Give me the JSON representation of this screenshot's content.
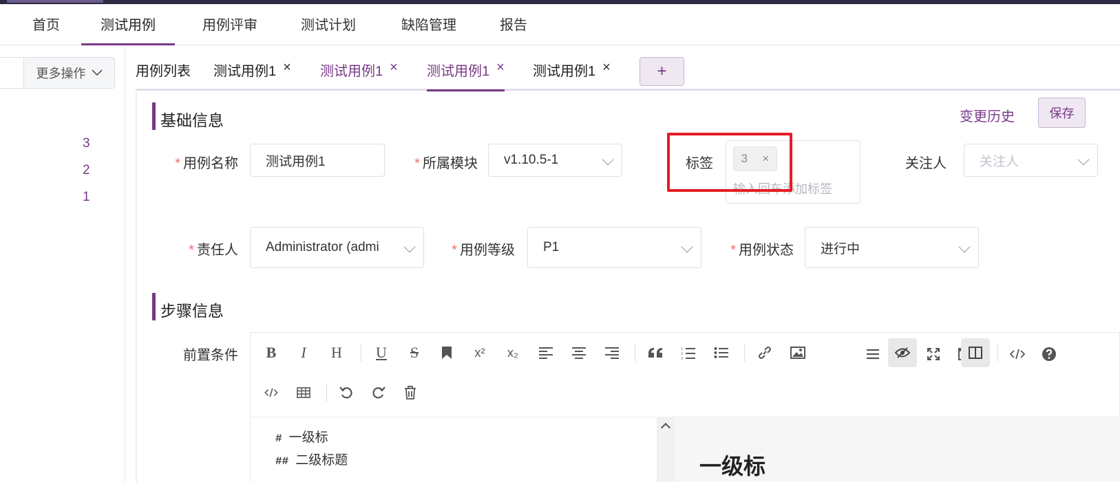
{
  "nav": {
    "items": [
      {
        "label": "首页"
      },
      {
        "label": "测试用例"
      },
      {
        "label": "用例评审"
      },
      {
        "label": "测试计划"
      },
      {
        "label": "缺陷管理"
      },
      {
        "label": "报告"
      }
    ],
    "active": "测试用例"
  },
  "left": {
    "more_label": "更多操作",
    "counts": [
      "3",
      "2",
      "1"
    ]
  },
  "tabs": {
    "items": [
      {
        "label": "用例列表"
      },
      {
        "label": "测试用例1"
      },
      {
        "label": "测试用例1"
      },
      {
        "label": "测试用例1"
      },
      {
        "label": "测试用例1"
      }
    ],
    "close_glyph": "×",
    "add_glyph": "+"
  },
  "basic": {
    "title": "基础信息",
    "history_label": "变更历史",
    "save_label": "保存",
    "name_label": "用例名称",
    "name_value": "测试用例1",
    "module_label": "所属模块",
    "module_value": "v1.10.5-1",
    "tag_label": "标签",
    "tag_chip": "3",
    "tag_chip_close": "×",
    "tag_placeholder": "输入回车添加标签",
    "follower_label": "关注人",
    "follower_placeholder": "关注人",
    "owner_label": "责任人",
    "owner_value": "Administrator (admi",
    "level_label": "用例等级",
    "level_value": "P1",
    "status_label": "用例状态",
    "status_value": "进行中",
    "required_mark": "*"
  },
  "steps": {
    "title": "步骤信息",
    "precondition_label": "前置条件"
  },
  "editor": {
    "toolbar1_left": [
      "B",
      "I",
      "H",
      "U",
      "S",
      "bookmark-icon",
      "x²",
      "x₂"
    ],
    "source_lines": [
      {
        "hash": "#",
        "text": "一级标"
      },
      {
        "hash": "##",
        "text": "二级标题"
      }
    ],
    "preview_h1": "一级标"
  },
  "colors": {
    "accent": "#783887",
    "highlight_box": "#e51c23",
    "required": "#f56c6c"
  }
}
